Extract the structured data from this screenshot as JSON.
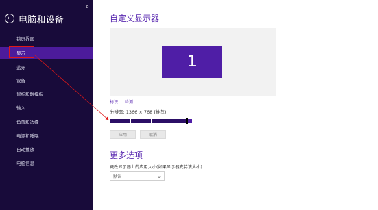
{
  "sidebar": {
    "title": "电脑和设备",
    "items": [
      {
        "label": "锁屏界面"
      },
      {
        "label": "显示"
      },
      {
        "label": "蓝牙"
      },
      {
        "label": "设备"
      },
      {
        "label": "鼠标和触摸板"
      },
      {
        "label": "输入"
      },
      {
        "label": "角落和边缘"
      },
      {
        "label": "电源和睡眠"
      },
      {
        "label": "自动播放"
      },
      {
        "label": "电脑信息"
      }
    ]
  },
  "main": {
    "heading": "自定义显示器",
    "monitor_label": "1",
    "links": [
      "标识",
      "检测"
    ],
    "resolution_label": "分辨率: 1366 × 768 (推荐)",
    "slider": {
      "value": 0.93
    },
    "buttons": {
      "apply": "应用",
      "cancel": "取消"
    },
    "more_heading": "更多选项",
    "more_desc": "更改显示器上的应用大小(如果显示器支持该大小)",
    "dropdown_value": "默认"
  },
  "colors": {
    "sidebar_bg": "#180b3a",
    "sidebar_active": "#4c1b9b",
    "accent": "#5b2bb1",
    "highlight_red": "#e01818"
  }
}
